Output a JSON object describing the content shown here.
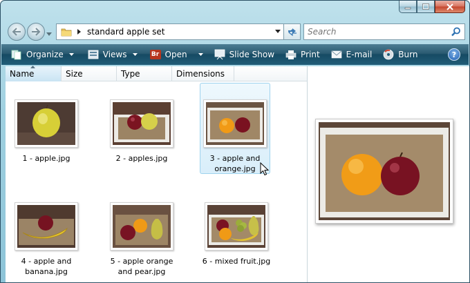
{
  "address": {
    "path": "standard apple set"
  },
  "search": {
    "placeholder": "Search"
  },
  "toolbar": {
    "organize": "Organize",
    "views": "Views",
    "open": "Open",
    "open_badge": "Br",
    "slideshow": "Slide Show",
    "print": "Print",
    "email": "E-mail",
    "burn": "Burn",
    "help": "?"
  },
  "columns": {
    "name": "Name",
    "size": "Size",
    "type": "Type",
    "dimensions": "Dimensions"
  },
  "files": [
    {
      "line1": "1 - apple.jpg",
      "line2": ""
    },
    {
      "line1": "2 - apples.jpg",
      "line2": ""
    },
    {
      "line1": "3 - apple and",
      "line2": "orange.jpg"
    },
    {
      "line1": "4 - apple and",
      "line2": "banana.jpg"
    },
    {
      "line1": "5 - apple orange",
      "line2": "and pear.jpg"
    },
    {
      "line1": "6 - mixed fruit.jpg",
      "line2": ""
    }
  ],
  "selected_index": 2,
  "colors": {
    "toolbar": "#215d78",
    "selection": "#d9eefa",
    "selection_border": "#9fd3ee",
    "close_button": "#c3452d"
  }
}
